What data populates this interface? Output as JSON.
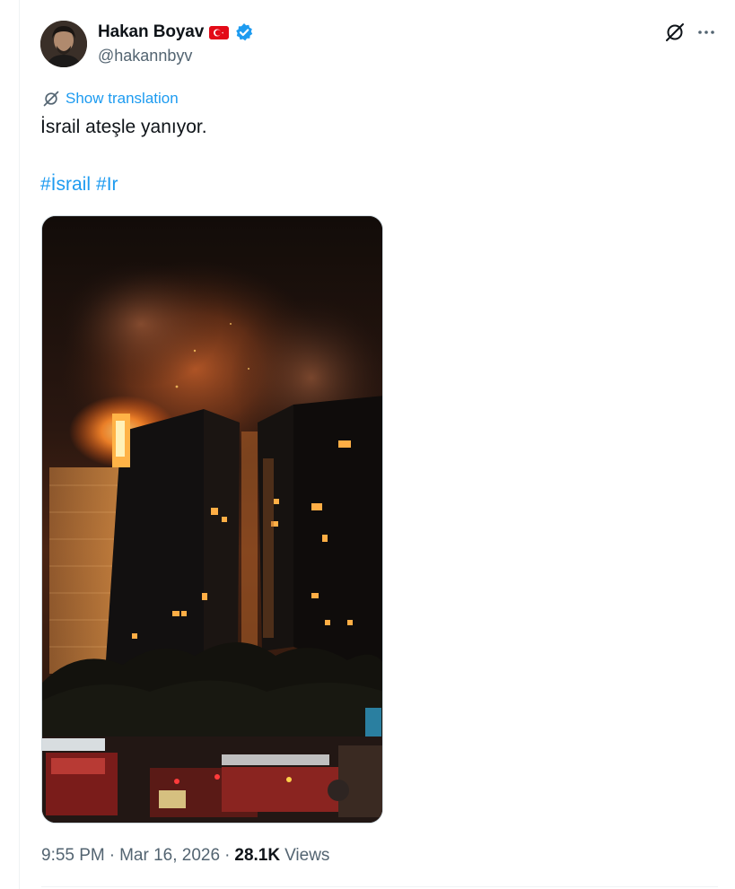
{
  "author": {
    "display_name": "Hakan Boyav",
    "handle": "@hakannbyv",
    "flag_icon": "turkey-flag-icon",
    "verified_icon": "verified-badge-icon",
    "verified_color": "#1d9bf0"
  },
  "header_actions": {
    "grok_icon": "grok-icon",
    "more_icon": "more-options-icon"
  },
  "translation": {
    "label": "Show translation",
    "icon": "translate-icon"
  },
  "tweet": {
    "text": "İsrail ateşle yanıyor.",
    "hashtags": [
      "#İsrail",
      "#Ir"
    ]
  },
  "media": {
    "type": "image"
  },
  "meta": {
    "time": "9:55 PM",
    "separator": "·",
    "date": "Mar 16, 2026",
    "views_count": "28.1K",
    "views_label": "Views"
  },
  "colors": {
    "accent": "#1d9bf0",
    "text_primary": "#0f1419",
    "text_secondary": "#536471",
    "border": "#eff3f4"
  }
}
